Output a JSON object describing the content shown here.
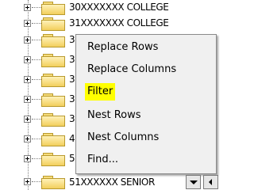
{
  "tree": {
    "rows": [
      {
        "label": "30XXXXXXX COLLEGE"
      },
      {
        "label": "31XXXXXXX COLLEGE"
      },
      {
        "label": "3"
      },
      {
        "label": "3"
      },
      {
        "label": "3"
      },
      {
        "label": "3"
      },
      {
        "label": "3"
      },
      {
        "label": "4"
      },
      {
        "label": "5"
      },
      {
        "label": "51XXXXXX SENIOR"
      }
    ]
  },
  "context_menu": {
    "items": [
      {
        "label": "Replace Rows"
      },
      {
        "label": "Replace Columns"
      },
      {
        "label": "Filter"
      },
      {
        "label": "Nest Rows"
      },
      {
        "label": "Nest Columns"
      },
      {
        "label": "Find..."
      }
    ],
    "highlighted_index": 2,
    "highlight_color": "#ffff00"
  },
  "icons": {
    "expand": "plus-box-icon",
    "folder": "folder-icon",
    "dropdown": "chevron-down-icon",
    "scroll_left": "arrow-left-icon"
  }
}
